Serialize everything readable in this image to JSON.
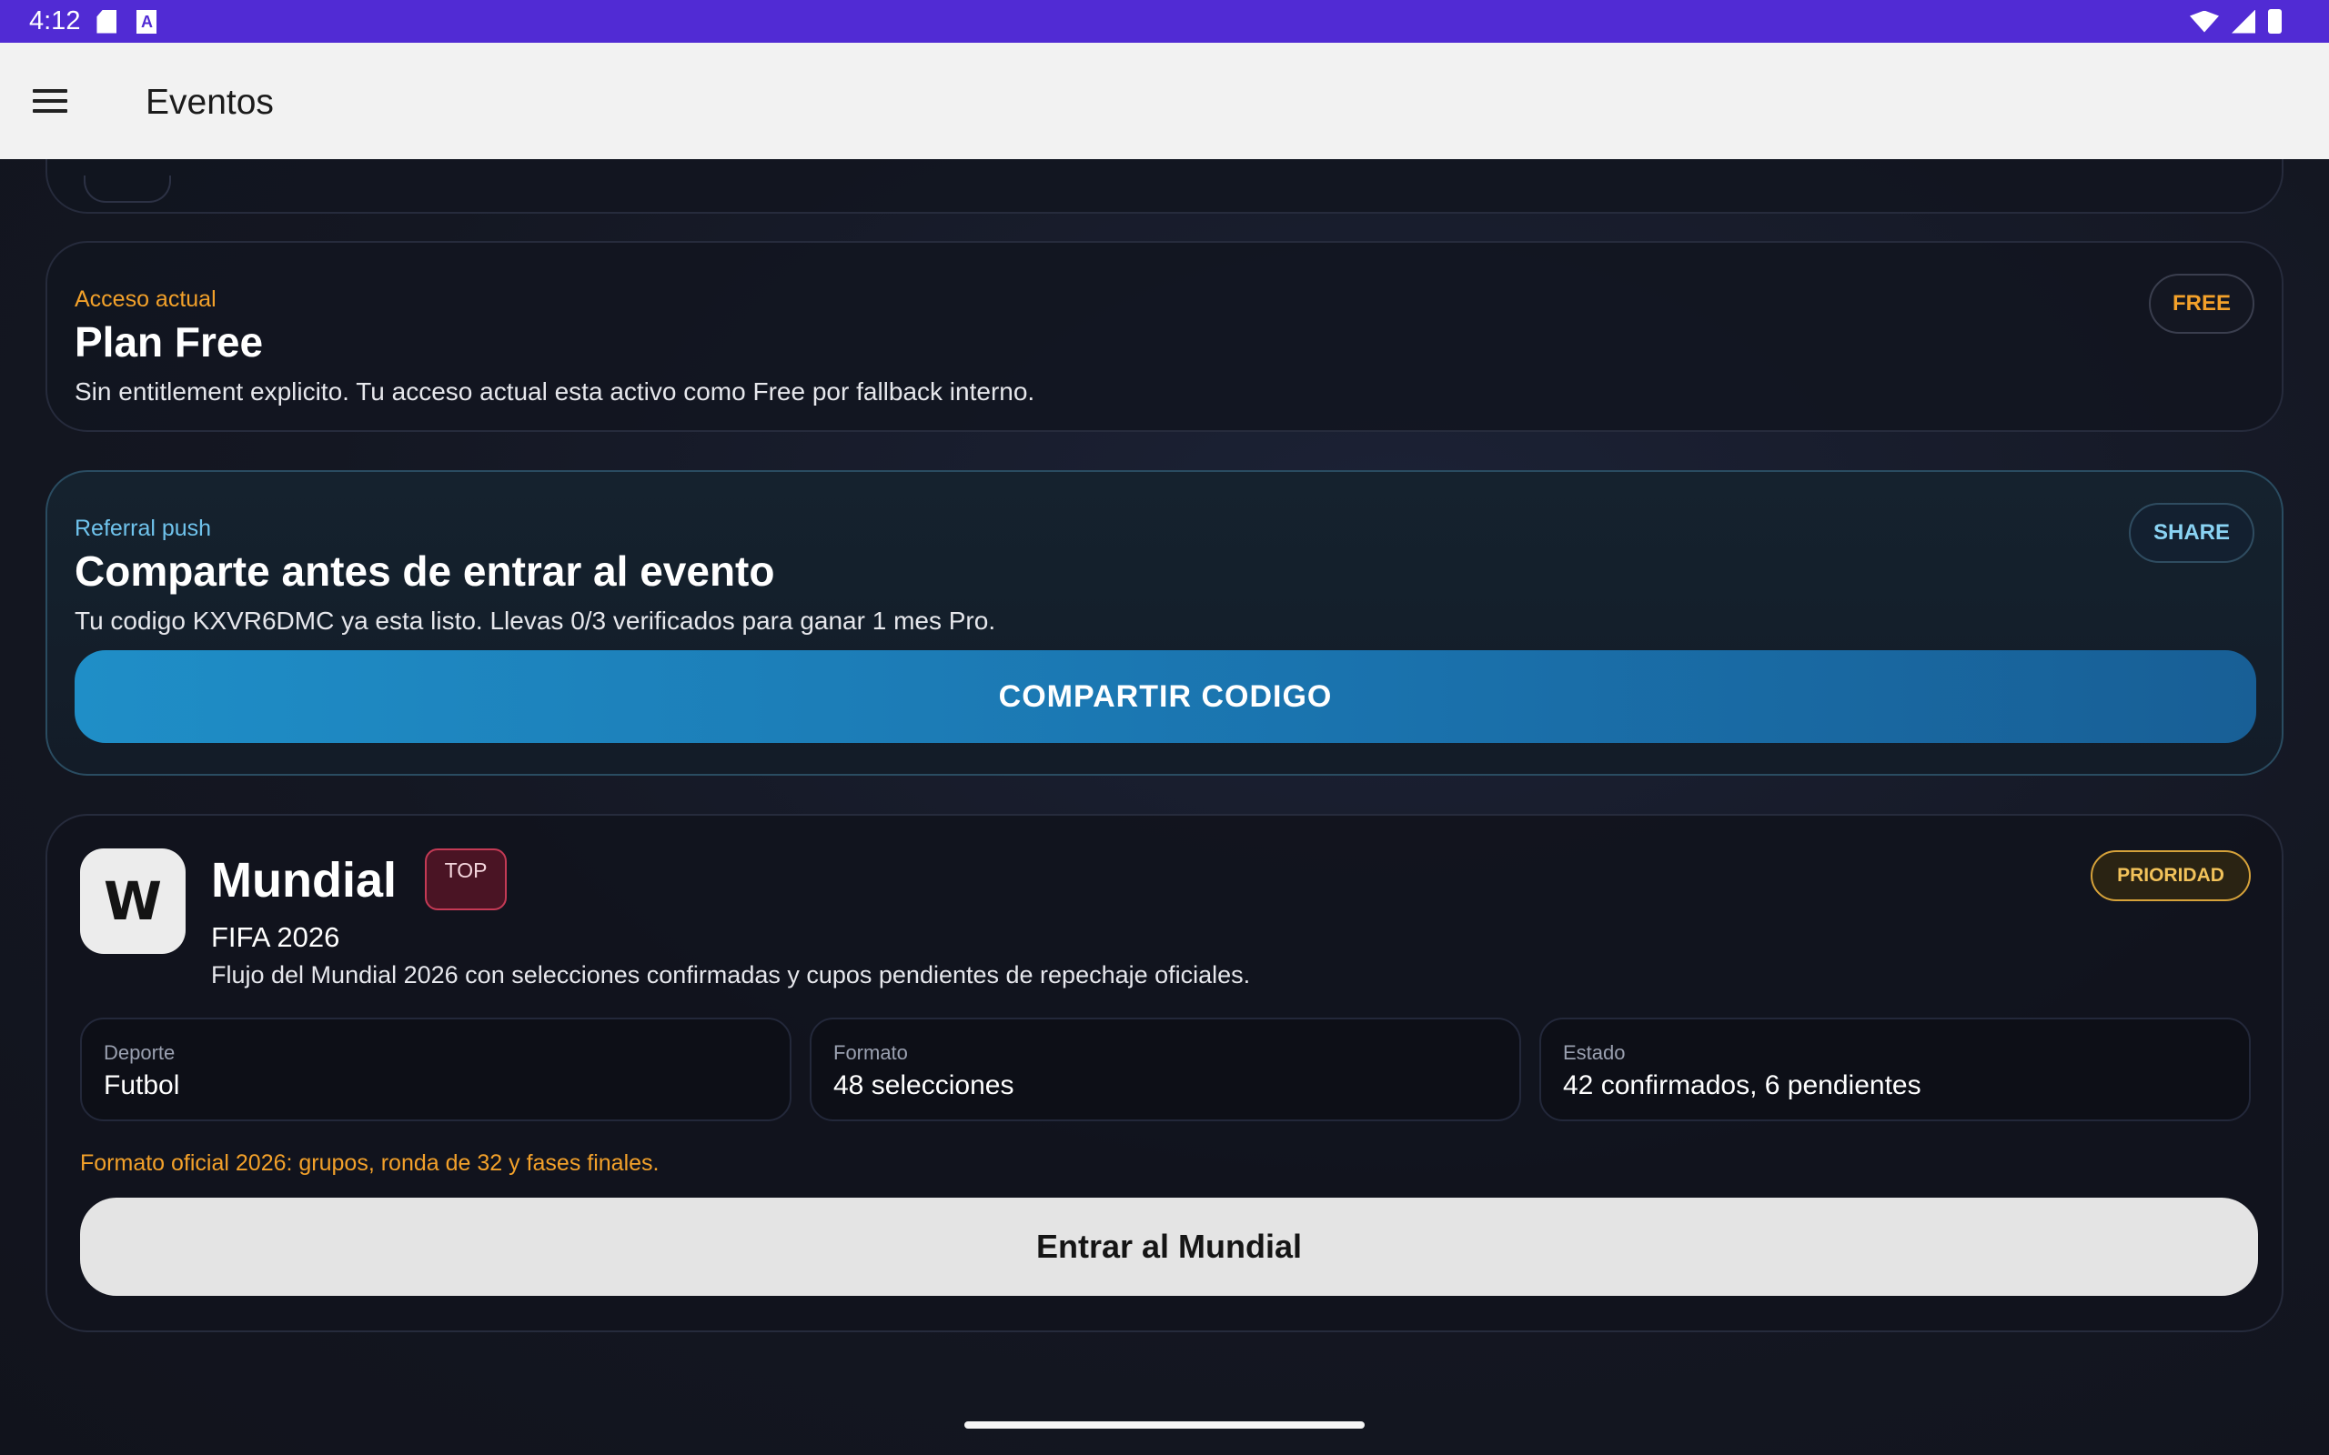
{
  "status_bar": {
    "time": "4:12",
    "icons": [
      "sd-card-icon",
      "a-icon",
      "wifi-icon",
      "signal-icon",
      "battery-icon"
    ],
    "a_glyph": "A"
  },
  "app_bar": {
    "title": "Eventos"
  },
  "plan_card": {
    "eyebrow": "Acceso actual",
    "title": "Plan Free",
    "description": "Sin entitlement explicito. Tu acceso actual esta activo como Free por fallback interno.",
    "chip": "FREE"
  },
  "referral_card": {
    "eyebrow": "Referral push",
    "title": "Comparte antes de entrar al evento",
    "description": "Tu codigo KXVR6DMC ya esta listo. Llevas 0/3 verificados para ganar 1 mes Pro.",
    "chip": "SHARE",
    "button_label": "COMPARTIR CODIGO"
  },
  "event_card": {
    "logo_glyph": "W",
    "title": "Mundial",
    "badge": "TOP",
    "priority_chip": "PRIORIDAD",
    "subtitle": "FIFA 2026",
    "description": "Flujo del Mundial 2026 con selecciones confirmadas y cupos pendientes de repechaje oficiales.",
    "stats": [
      {
        "label": "Deporte",
        "value": "Futbol"
      },
      {
        "label": "Formato",
        "value": "48 selecciones"
      },
      {
        "label": "Estado",
        "value": "42 confirmados, 6 pendientes"
      }
    ],
    "format_note": "Formato oficial 2026: grupos, ronda de 32 y fases finales.",
    "button_label": "Entrar al Mundial"
  },
  "colors": {
    "status_bar": "#512bd4",
    "accent_orange": "#f3a12a",
    "accent_blue": "#1f8ec7",
    "top_badge": "#c43a55"
  }
}
